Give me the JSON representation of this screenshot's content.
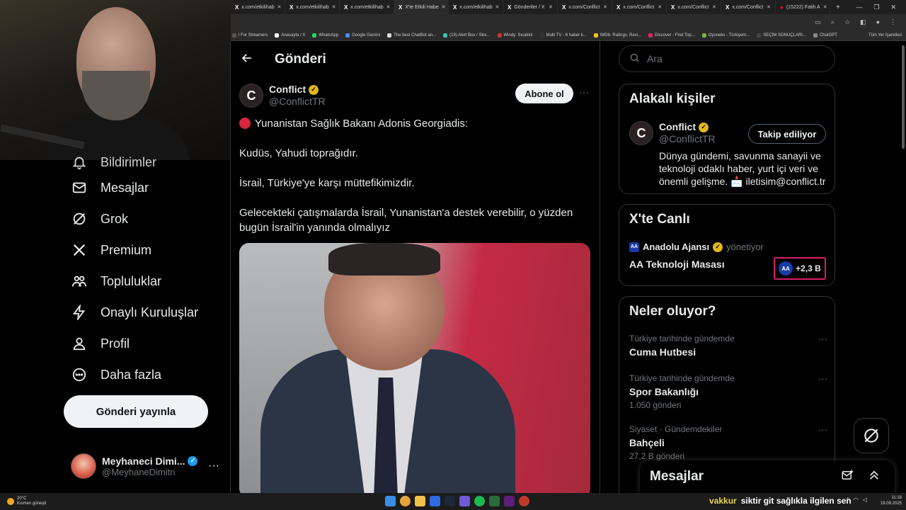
{
  "browser": {
    "tabs": [
      {
        "label": "x.com/etkilihab"
      },
      {
        "label": "x.com/etkilihab"
      },
      {
        "label": "x.com/etkilihab"
      },
      {
        "label": "X'te Etkili Habe"
      },
      {
        "label": "x.com/etkilihab"
      },
      {
        "label": "Gönderiler / X"
      },
      {
        "label": "x.com/Conflict"
      },
      {
        "label": "x.com/Conflict"
      },
      {
        "label": "x.com/Conflict"
      },
      {
        "label": "x.com/Conflict"
      },
      {
        "label": "(15222) Fatih A"
      }
    ],
    "bookmarks": [
      {
        "label": "l For Streamers",
        "color": "#555555"
      },
      {
        "label": "Anasayfa / X",
        "color": "#ffffff"
      },
      {
        "label": "WhatsApp",
        "color": "#25d366"
      },
      {
        "label": "Google Gemini",
        "color": "#4a8cf7"
      },
      {
        "label": "The best ChatBot an...",
        "color": "#dddddd"
      },
      {
        "label": "(19) Alert Box / Stre...",
        "color": "#39c3a8"
      },
      {
        "label": "Windy: Sıcaklık",
        "color": "#c0392b"
      },
      {
        "label": "Multi TV - 6 haber k...",
        "color": "#333333"
      },
      {
        "label": "IMDb: Ratings, Revi...",
        "color": "#f5c518"
      },
      {
        "label": "Discover - Find Top...",
        "color": "#e0245e"
      },
      {
        "label": "Oyuneks - Türkiyem...",
        "color": "#7bb241"
      },
      {
        "label": "SEÇİM SONUÇLARI...",
        "color": "#444444"
      },
      {
        "label": "ChatGPT",
        "color": "#888888"
      }
    ],
    "bookmarks_right": "Tüm Yer İşaretleri"
  },
  "nav": {
    "items": [
      {
        "label": "Bildirimler",
        "icon": "bell-icon"
      },
      {
        "label": "Mesajlar",
        "icon": "mail-icon"
      },
      {
        "label": "Grok",
        "icon": "grok-icon"
      },
      {
        "label": "Premium",
        "icon": "x-logo-icon"
      },
      {
        "label": "Topluluklar",
        "icon": "communities-icon"
      },
      {
        "label": "Onaylı Kuruluşlar",
        "icon": "lightning-icon"
      },
      {
        "label": "Profil",
        "icon": "person-icon"
      },
      {
        "label": "Daha fazla",
        "icon": "more-circle-icon"
      }
    ],
    "post_button": "Gönderi yayınla",
    "account": {
      "name": "Meyhaneci Dimi...",
      "handle": "@MeyhaneDimitri"
    }
  },
  "main": {
    "title": "Gönderi",
    "post": {
      "author": "Conflict",
      "handle": "@ConflictTR",
      "subscribe": "Abone ol",
      "lines": [
        "Yunanistan Sağlık Bakanı Adonis Georgiadis:",
        "Kudüs, Yahudi toprağıdır.",
        "İsrail, Türkiye'ye karşı müttefikimizdir.",
        "Gelecekteki çatışmalarda İsrail, Yunanistan'a destek verebilir, o yüzden bugün İsrail'in yanında olmalıyız"
      ]
    }
  },
  "right": {
    "search_placeholder": "Ara",
    "related": {
      "title": "Alakalı kişiler",
      "name": "Conflict",
      "handle": "@ConflictTR",
      "follow": "Takip ediliyor",
      "bio": "Dünya gündemi, savunma sanayii ve teknoloji odaklı haber, yurt içi veri ve önemli gelişme. 📩 iletisim@conflict.tr"
    },
    "live": {
      "title": "X'te Canlı",
      "host": "Anadolu Ajansı",
      "role": "yönetiyor",
      "space": "AA Teknoloji Masası",
      "listeners": "+2,3 B",
      "accent": "#d61f69"
    },
    "trends": {
      "title": "Neler oluyor?",
      "items": [
        {
          "category": "Türkiye tarihinde gündemde",
          "name": "Cuma Hutbesi",
          "count": ""
        },
        {
          "category": "Türkiye tarihinde gündemde",
          "name": "Spor Bakanlığı",
          "count": "1.050 gönderi"
        },
        {
          "category": "Siyaset · Gündemdekiler",
          "name": "Bahçeli",
          "count": "27,2 B gönderi"
        }
      ]
    },
    "messages_drawer": "Mesajlar"
  },
  "taskbar": {
    "weather_temp": "20°C",
    "weather_desc": "Kısmen güneşli",
    "ticker_name": "vakkur",
    "ticker_text": "siktir git sağlıkla ilgilen sen",
    "time": "11:18",
    "date": "19.09.2025"
  }
}
